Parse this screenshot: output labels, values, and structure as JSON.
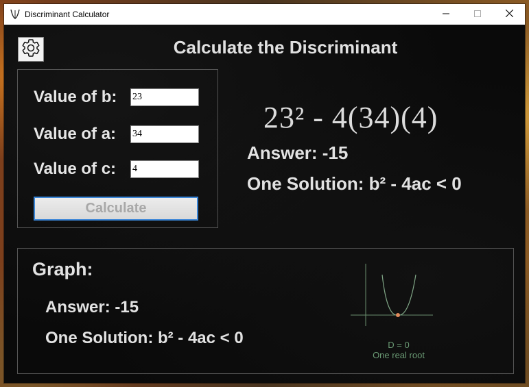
{
  "window": {
    "title": "Discriminant Calculator",
    "icon": "parabola-icon",
    "controls": [
      "minimize-icon",
      "maximize-icon",
      "close-icon"
    ]
  },
  "header": {
    "settings_icon": "gear-icon",
    "title": "Calculate the Discriminant"
  },
  "inputs": {
    "b": {
      "label": "Value of b:",
      "value": "23"
    },
    "a": {
      "label": "Value of a:",
      "value": "34"
    },
    "c": {
      "label": "Value of c:",
      "value": "4"
    },
    "calculate_label": "Calculate"
  },
  "result": {
    "equation": "23² - 4(34)(4)",
    "answer": "Answer: -15",
    "solution": "One Solution: b² - 4ac < 0"
  },
  "graph": {
    "heading": "Graph:",
    "answer": "Answer: -15",
    "solution": "One Solution: b² - 4ac < 0",
    "caption_d": "D = 0",
    "caption_roots": "One real root",
    "curve_color": "#7fa585",
    "vertex_color": "#e08a5c"
  },
  "colors": {
    "accent": "#3a86d8",
    "background": "#0a0a0a",
    "text": "#e2e2e2"
  }
}
